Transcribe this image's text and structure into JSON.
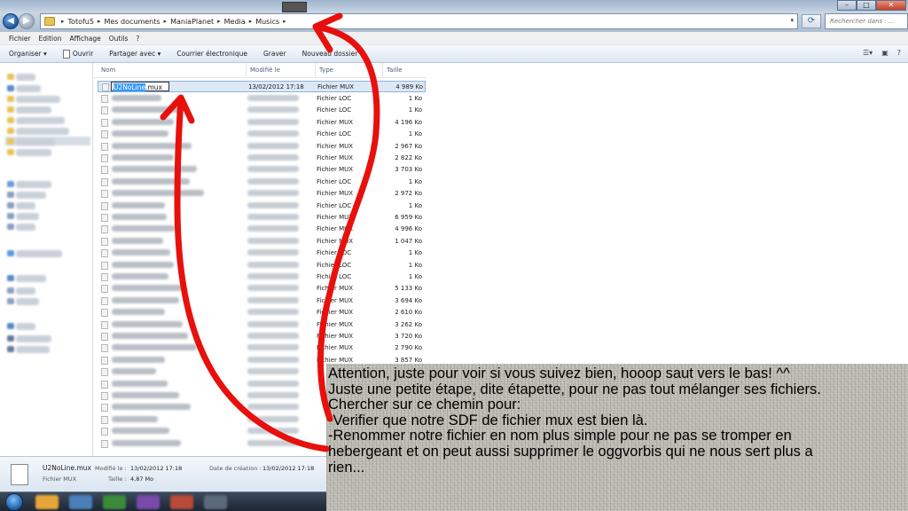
{
  "window": {
    "breadcrumb": [
      "Totofu5",
      "Mes documents",
      "ManiaPlanet",
      "Media",
      "Musics"
    ],
    "search_placeholder": "Rechercher dans : ...",
    "minimize": "–",
    "maximize": "□",
    "close": "✕"
  },
  "menu": [
    "Fichier",
    "Edition",
    "Affichage",
    "Outils",
    "?"
  ],
  "toolbar": {
    "organize": "Organiser ▾",
    "open": "Ouvrir",
    "share": "Partager avec ▾",
    "email": "Courrier électronique",
    "burn": "Graver",
    "new_folder": "Nouveau dossier"
  },
  "columns": {
    "name": "Nom",
    "modified": "Modifié le",
    "type": "Type",
    "size": "Taille"
  },
  "selected_file": {
    "rename_highlight": "U2NoLine",
    "rename_ext": ".mux",
    "modified": "13/02/2012 17:18",
    "type": "Fichier MUX",
    "size": "4 989 Ko"
  },
  "files": [
    {
      "type": "Fichier LOC",
      "size": "1 Ko"
    },
    {
      "type": "Fichier LOC",
      "size": "1 Ko"
    },
    {
      "type": "Fichier MUX",
      "size": "4 196 Ko"
    },
    {
      "type": "Fichier LOC",
      "size": "1 Ko"
    },
    {
      "type": "Fichier MUX",
      "size": "2 967 Ko"
    },
    {
      "type": "Fichier MUX",
      "size": "2 822 Ko"
    },
    {
      "type": "Fichier MUX",
      "size": "3 703 Ko"
    },
    {
      "type": "Fichier LOC",
      "size": "1 Ko"
    },
    {
      "type": "Fichier MUX",
      "size": "2 972 Ko"
    },
    {
      "type": "Fichier LOC",
      "size": "1 Ko"
    },
    {
      "type": "Fichier MUX",
      "size": "6 959 Ko"
    },
    {
      "type": "Fichier MUX",
      "size": "4 996 Ko"
    },
    {
      "type": "Fichier MUX",
      "size": "1 047 Ko"
    },
    {
      "type": "Fichier LOC",
      "size": "1 Ko"
    },
    {
      "type": "Fichier LOC",
      "size": "1 Ko"
    },
    {
      "type": "Fichier LOC",
      "size": "1 Ko"
    },
    {
      "type": "Fichier MUX",
      "size": "5 133 Ko"
    },
    {
      "type": "Fichier MUX",
      "size": "3 694 Ko"
    },
    {
      "type": "Fichier MUX",
      "size": "2 610 Ko"
    },
    {
      "type": "Fichier MUX",
      "size": "3 262 Ko"
    },
    {
      "type": "Fichier MUX",
      "size": "3 720 Ko"
    },
    {
      "type": "Fichier MUX",
      "size": "2 790 Ko"
    },
    {
      "type": "Fichier MUX",
      "size": "3 857 Ko"
    }
  ],
  "details": {
    "name": "U2NoLine.mux",
    "type": "Fichier MUX",
    "modified_label": "Modifié le :",
    "modified": "13/02/2012 17:18",
    "size_label": "Taille :",
    "size": "4,87 Mo",
    "created_label": "Date de création :",
    "created": "13/02/2012 17:18"
  },
  "annotation": {
    "lines": [
      "Attention, juste pour voir si vous suivez bien, hooop saut vers le bas! ^^",
      "Juste une petite étape, dite étapette, pour ne pas tout mélanger ses fichiers.",
      "Chercher sur ce chemin pour:",
      "-Verifier que notre SDF de fichier mux est bien là.",
      "-Renommer notre fichier en nom plus simple pour ne pas se tromper en",
      "hebergeant et on peut aussi supprimer le oggvorbis qui ne nous sert plus a",
      "rien..."
    ],
    "arrow_color": "#e8100c"
  }
}
